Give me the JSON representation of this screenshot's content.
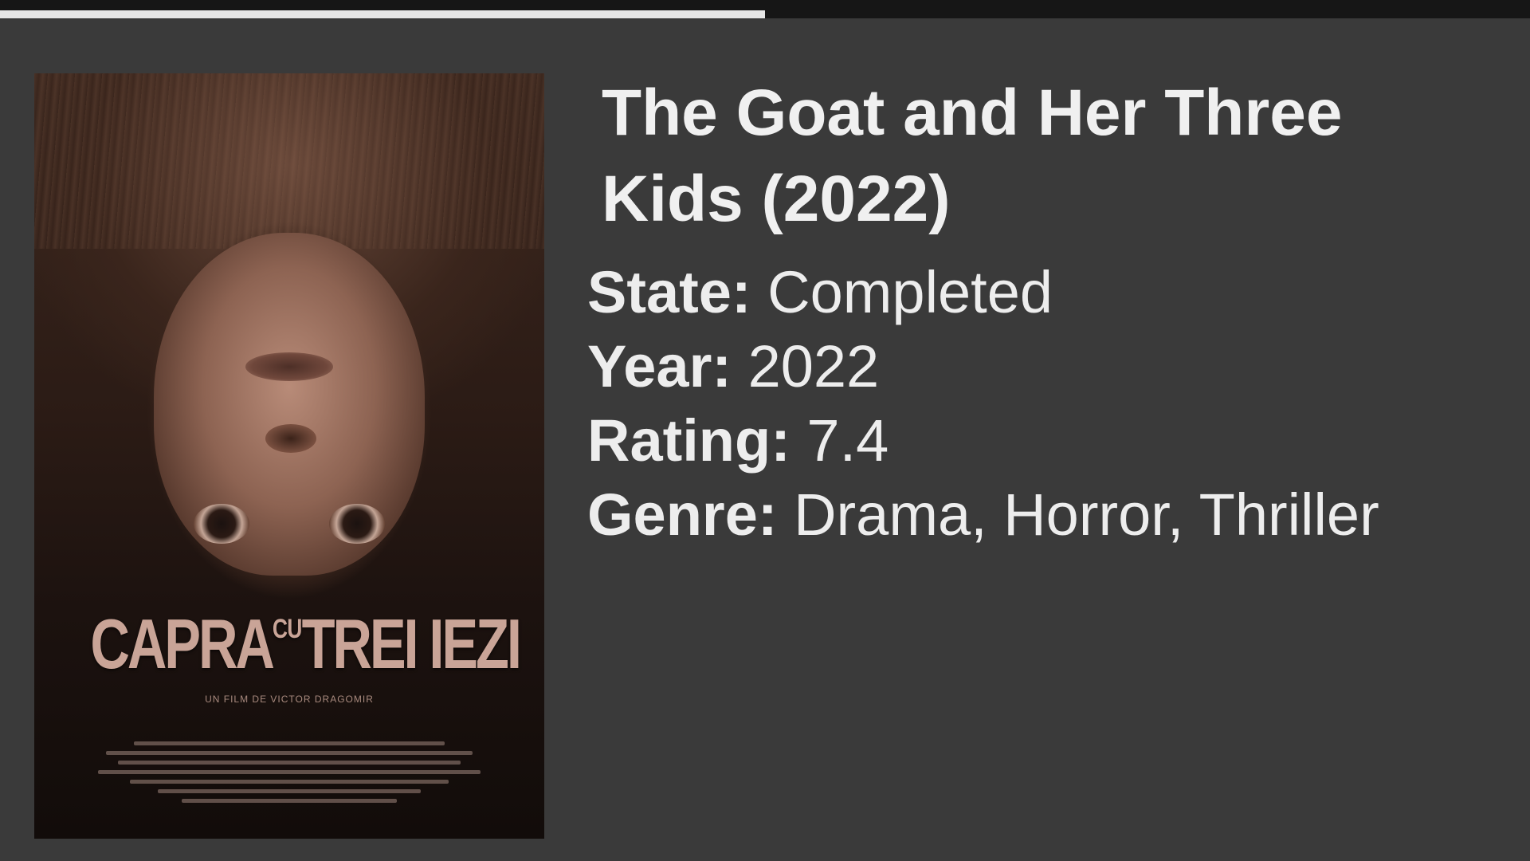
{
  "progress": {
    "value": 0.5
  },
  "poster": {
    "title_main": "CAPRA",
    "title_small": "CU",
    "title_end": "TREI IEZI",
    "credit": "UN FILM DE VICTOR DRAGOMIR"
  },
  "movie": {
    "title": "The Goat and Her Three Kids (2022)",
    "fields": [
      {
        "key": "State:",
        "value": "Completed"
      },
      {
        "key": "Year:",
        "value": "2022"
      },
      {
        "key": "Rating:",
        "value": "7.4"
      },
      {
        "key": "Genre:",
        "value": "Drama, Horror, Thriller"
      }
    ]
  },
  "colors": {
    "background": "#3a3a3a",
    "top_bar": "#161616",
    "progress": "#e6e6e6",
    "text": "#ececec"
  }
}
